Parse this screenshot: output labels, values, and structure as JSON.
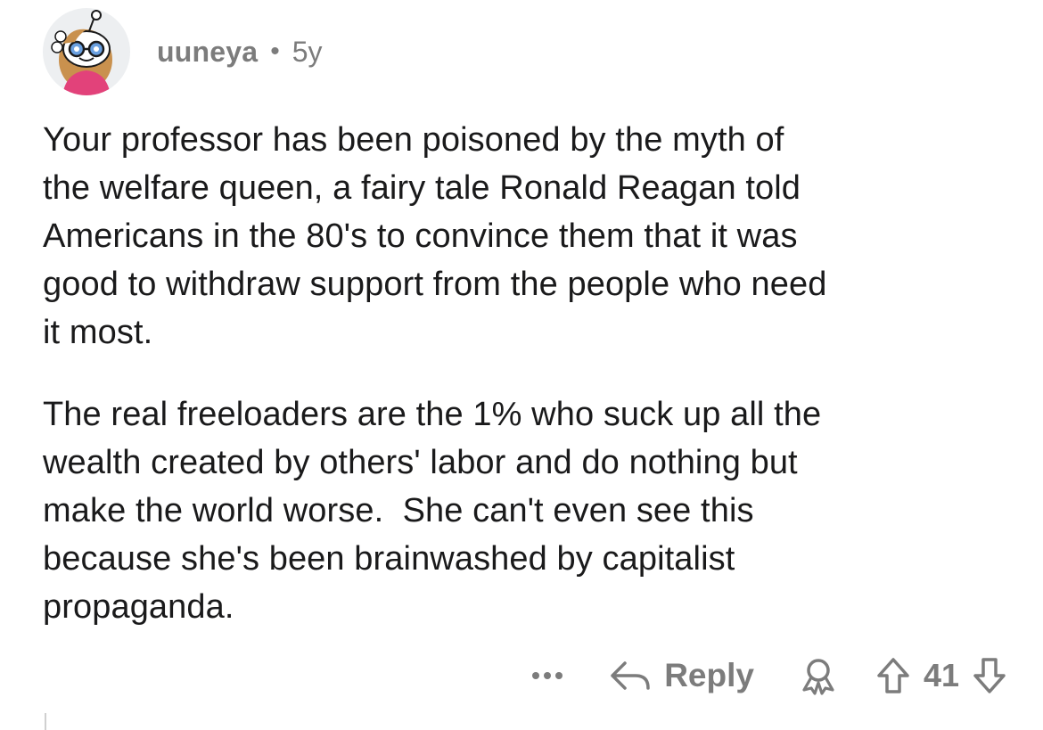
{
  "comment": {
    "author": "uuneya",
    "separator": "•",
    "age": "5y",
    "paragraphs": [
      "Your professor has been poisoned by the myth of\nthe welfare queen, a fairy tale Ronald Reagan told\nAmericans in the 80's to convince them that it was\ngood to withdraw support from the people who need\nit most.",
      "The real freeloaders are the 1% who suck up all the\nwealth created by others' labor and do nothing but\nmake the world worse.  She can't even see this\nbecause she's been brainwashed by capitalist\npropaganda."
    ]
  },
  "actions": {
    "more_icon": "ellipsis-icon",
    "reply_icon": "reply-arrow-icon",
    "reply_label": "Reply",
    "award_icon": "award-icon",
    "upvote_icon": "upvote-arrow-icon",
    "score": "41",
    "downvote_icon": "downvote-arrow-icon"
  },
  "colors": {
    "text": "#1a1a1b",
    "muted": "#7c7c7c",
    "background": "#ffffff"
  }
}
